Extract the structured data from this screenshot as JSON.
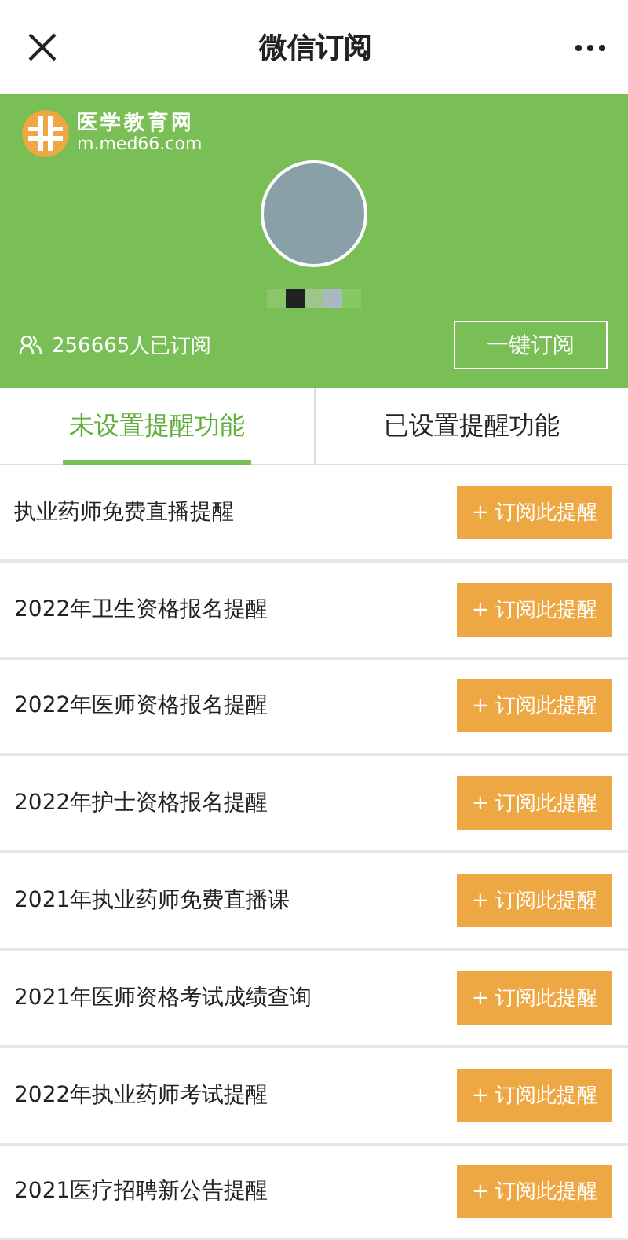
{
  "window": {
    "title": "微信订阅"
  },
  "banner": {
    "logo_name": "医学教育网",
    "logo_url": "m.med66.com",
    "subscriber_count": "256665人已订阅",
    "subscribe_all_button": "一键订阅"
  },
  "tabs": [
    {
      "label": "未设置提醒功能",
      "selected": true
    },
    {
      "label": "已设置提醒功能",
      "selected": false
    }
  ],
  "reminders": [
    {
      "title": "执业药师免费直播提醒",
      "button": "+ 订阅此提醒"
    },
    {
      "title": "2022年卫生资格报名提醒",
      "button": "+ 订阅此提醒"
    },
    {
      "title": "2022年医师资格报名提醒",
      "button": "+ 订阅此提醒"
    },
    {
      "title": "2022年护士资格报名提醒",
      "button": "+ 订阅此提醒"
    },
    {
      "title": "2021年执业药师免费直播课",
      "button": "+ 订阅此提醒"
    },
    {
      "title": "2021年医师资格考试成绩查询",
      "button": "+ 订阅此提醒"
    },
    {
      "title": "2022年执业药师考试提醒",
      "button": "+ 订阅此提醒"
    },
    {
      "title": "2021医疗招聘新公告提醒",
      "button": "+ 订阅此提醒"
    }
  ]
}
